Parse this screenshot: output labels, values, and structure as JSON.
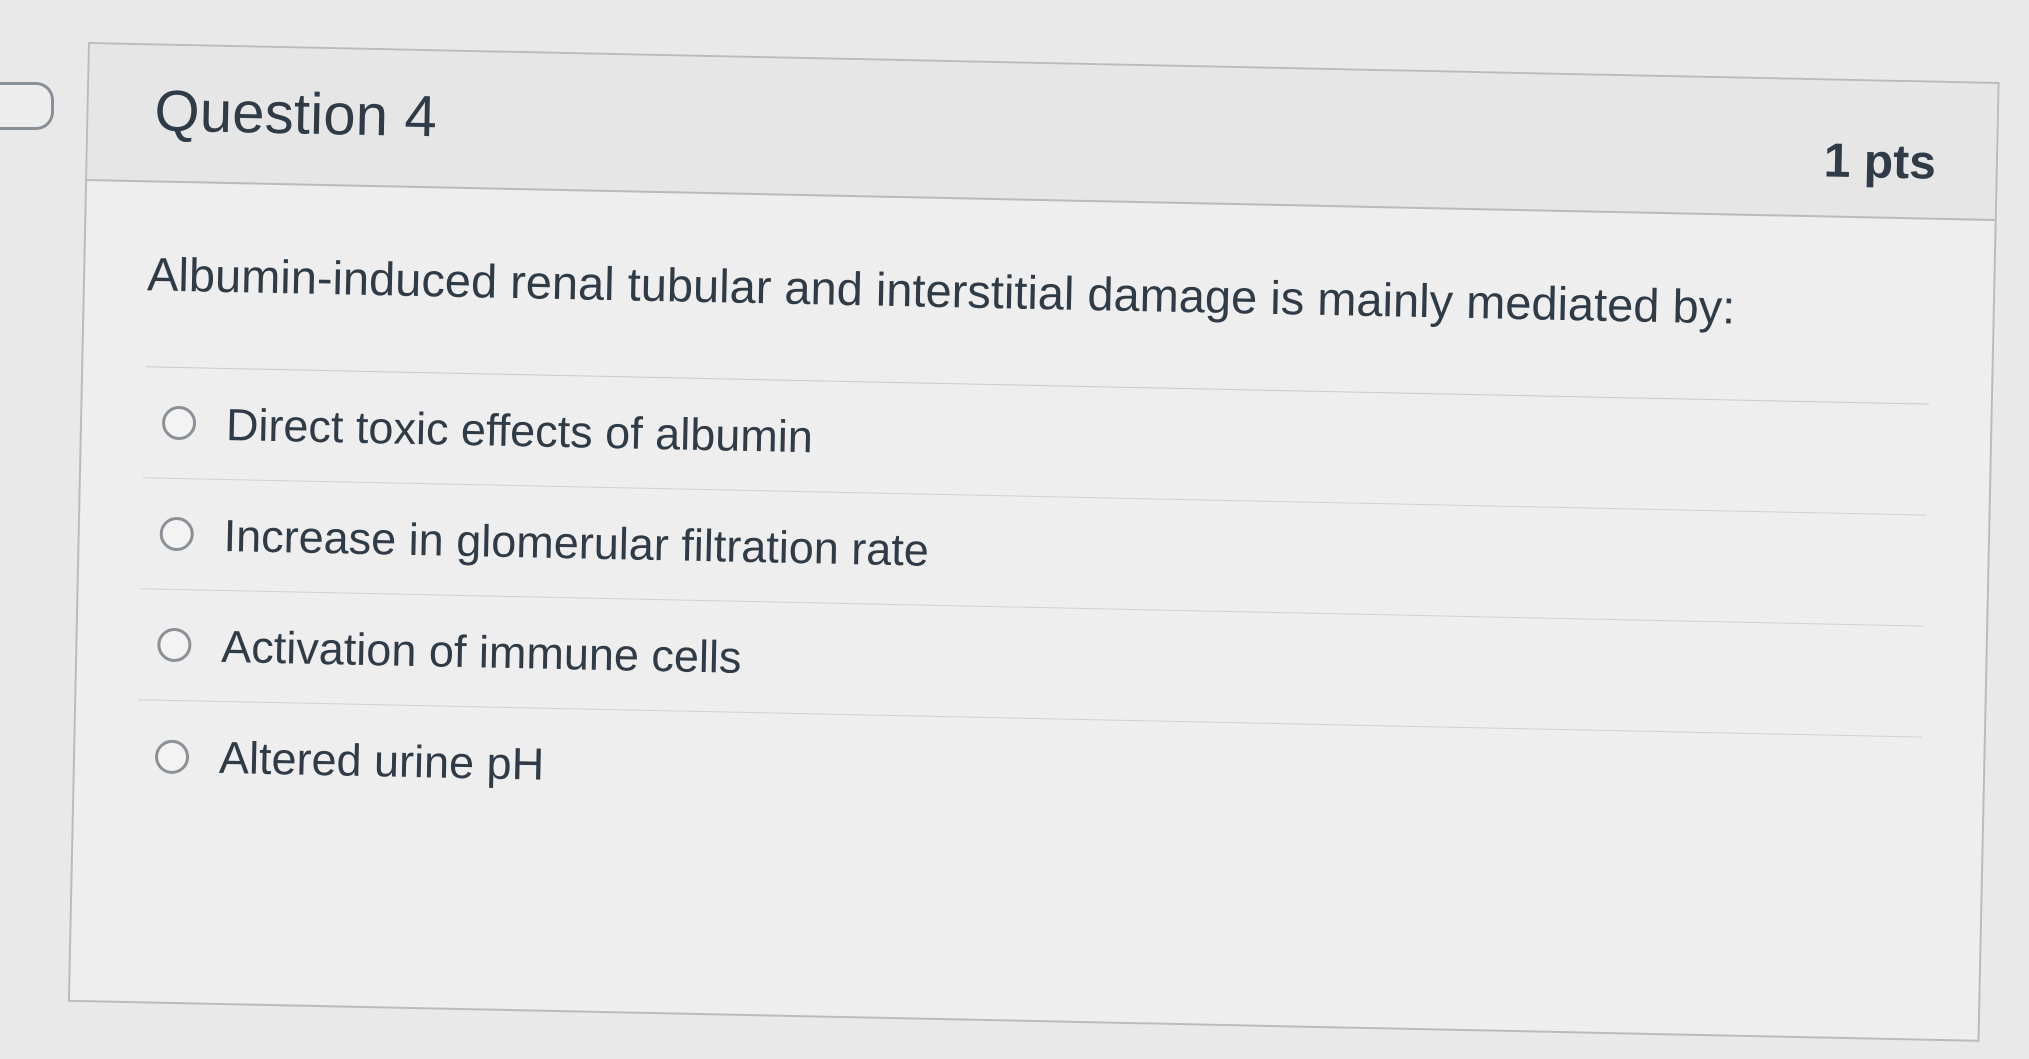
{
  "question": {
    "title": "Question 4",
    "points": "1 pts",
    "text": "Albumin-induced renal tubular and interstitial damage is mainly mediated by:",
    "answers": [
      {
        "label": "Direct toxic effects of albumin"
      },
      {
        "label": "Increase in glomerular filtration rate"
      },
      {
        "label": "Activation of immune cells"
      },
      {
        "label": "Altered urine pH"
      }
    ]
  },
  "icons": {
    "question_flag": "bookmark-flag-icon",
    "answer_choice": "radio-button-icon"
  }
}
